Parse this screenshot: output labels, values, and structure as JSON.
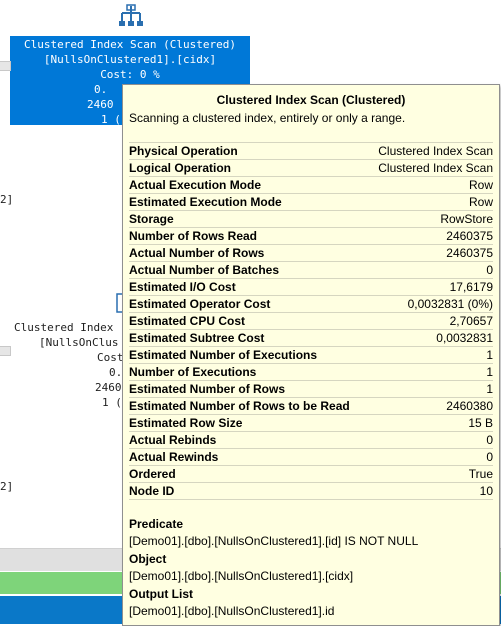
{
  "plan": {
    "node1": {
      "line1": "Clustered Index Scan (Clustered)",
      "line2": "[NullsOnClustered1].[cidx]",
      "line3": "Cost: 0 %",
      "line4": "0.",
      "line5": "2460",
      "line6": "1 ("
    },
    "node2": {
      "line1": "Clustered Index",
      "line2": "[NullsOnClus",
      "line3": "Cost",
      "line4": "0.",
      "line5": "2460",
      "line6": "1 ("
    },
    "left_frag_1": "2]",
    "left_frag_2": "2]"
  },
  "tooltip": {
    "title": "Clustered Index Scan (Clustered)",
    "description": "Scanning a clustered index, entirely or only a range.",
    "rows": [
      {
        "key": "Physical Operation",
        "value": "Clustered Index Scan"
      },
      {
        "key": "Logical Operation",
        "value": "Clustered Index Scan"
      },
      {
        "key": "Actual Execution Mode",
        "value": "Row"
      },
      {
        "key": "Estimated Execution Mode",
        "value": "Row"
      },
      {
        "key": "Storage",
        "value": "RowStore"
      },
      {
        "key": "Number of Rows Read",
        "value": "2460375"
      },
      {
        "key": "Actual Number of Rows",
        "value": "2460375"
      },
      {
        "key": "Actual Number of Batches",
        "value": "0"
      },
      {
        "key": "Estimated I/O Cost",
        "value": "17,6179"
      },
      {
        "key": "Estimated Operator Cost",
        "value": "0,0032831 (0%)"
      },
      {
        "key": "Estimated CPU Cost",
        "value": "2,70657"
      },
      {
        "key": "Estimated Subtree Cost",
        "value": "0,0032831"
      },
      {
        "key": "Estimated Number of Executions",
        "value": "1"
      },
      {
        "key": "Number of Executions",
        "value": "1"
      },
      {
        "key": "Estimated Number of Rows",
        "value": "1"
      },
      {
        "key": "Estimated Number of Rows to be Read",
        "value": "2460380"
      },
      {
        "key": "Estimated Row Size",
        "value": "15 B"
      },
      {
        "key": "Actual Rebinds",
        "value": "0"
      },
      {
        "key": "Actual Rewinds",
        "value": "0"
      },
      {
        "key": "Ordered",
        "value": "True"
      },
      {
        "key": "Node ID",
        "value": "10"
      }
    ],
    "predicate_label": "Predicate",
    "predicate_value": "[Demo01].[dbo].[NullsOnClustered1].[id] IS NOT NULL",
    "object_label": "Object",
    "object_value": "[Demo01].[dbo].[NullsOnClustered1].[cidx]",
    "output_label": "Output List",
    "output_value": "[Demo01].[dbo].[NullsOnClustered1].id"
  },
  "colors": {
    "selected_node": "#0078d7",
    "tooltip_bg": "#ffffe1",
    "status_green": "#7ed47a",
    "status_blue": "#0a78c8"
  },
  "icons": [
    "clustered-index-scan-icon"
  ]
}
